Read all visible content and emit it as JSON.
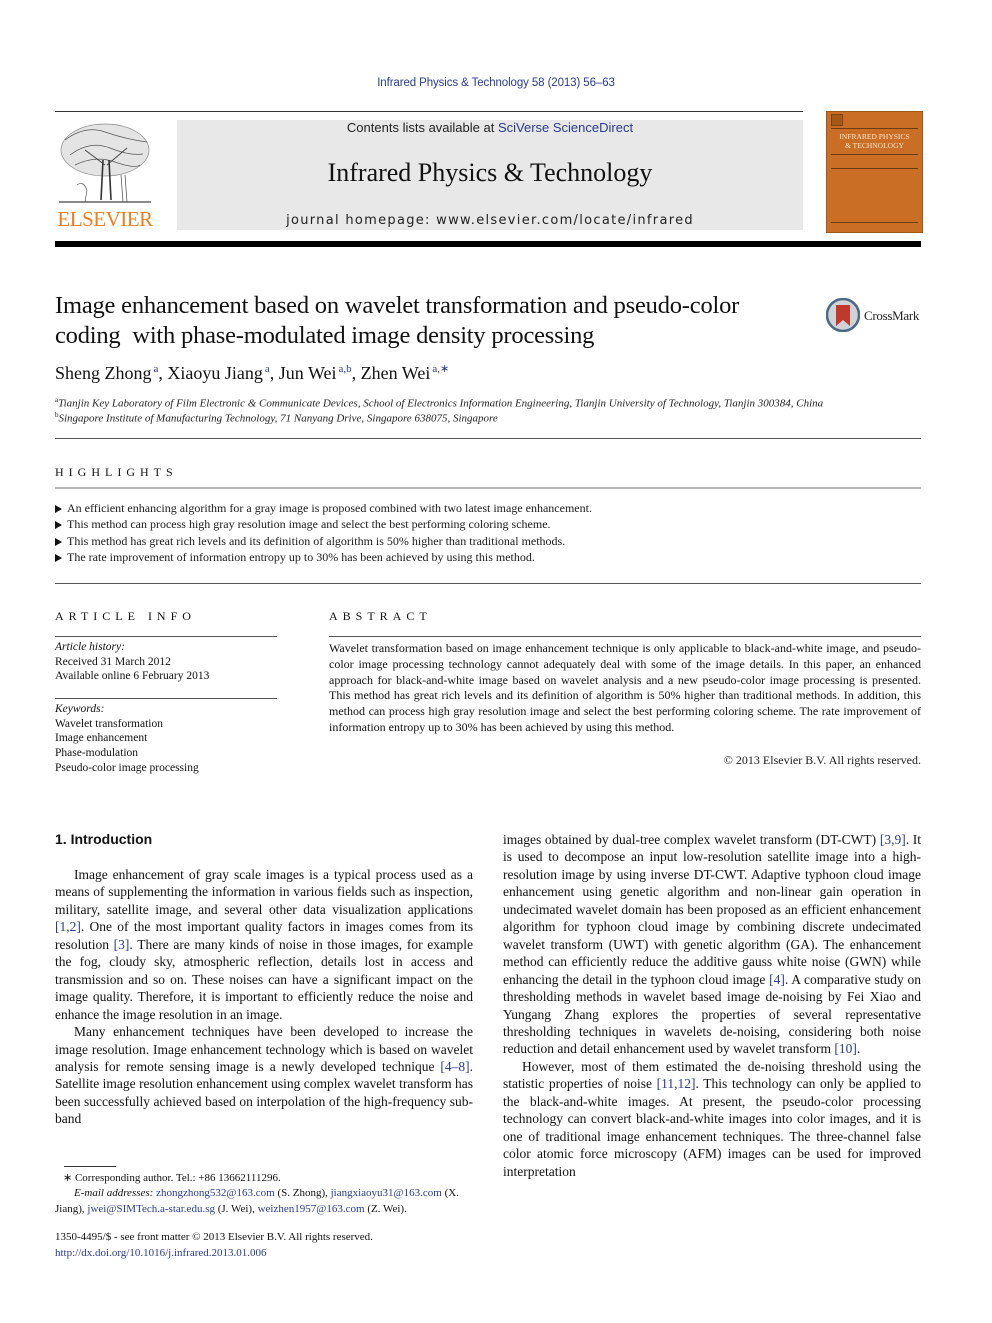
{
  "header": {
    "citation": "Infrared Physics & Technology 58 (2013) 56–63",
    "contents_prefix": "Contents lists available at ",
    "contents_link": "SciVerse ScienceDirect",
    "journal_title": "Infrared Physics & Technology",
    "homepage_label": "journal homepage: ",
    "homepage_url": "www.elsevier.com/locate/infrared",
    "publisher_logo_text": "ELSEVIER",
    "cover_title_line1": "INFRARED PHYSICS",
    "cover_title_line2": "& TECHNOLOGY",
    "crossmark_label": "CrossMark"
  },
  "colors": {
    "link": "#2a3a8c",
    "elsevier_orange": "#f07c1c",
    "cover_orange": "#c96e24",
    "header_gray": "#e8e8e8"
  },
  "article": {
    "title_line1": "Image enhancement based on wavelet transformation and pseudo-color",
    "title_line2": "coding  with phase-modulated image density processing",
    "authors": [
      {
        "name": "Sheng Zhong",
        "sup": "a",
        "sep": ", "
      },
      {
        "name": "Xiaoyu Jiang",
        "sup": "a",
        "sep": ", "
      },
      {
        "name": "Jun Wei",
        "sup": "a,b",
        "sep": ", "
      },
      {
        "name": "Zhen Wei",
        "sup": "a,∗",
        "sep": ""
      }
    ],
    "affiliations": [
      {
        "mark": "a",
        "text": "Tianjin Key Laboratory of Film Electronic & Communicate Devices, School of Electronics Information Engineering, Tianjin University of Technology, Tianjin 300384, China"
      },
      {
        "mark": "b",
        "text": "Singapore Institute of Manufacturing Technology, 71 Nanyang Drive, Singapore 638075, Singapore"
      }
    ]
  },
  "highlights": {
    "title": "HIGHLIGHTS",
    "items": [
      "An efficient enhancing algorithm for a gray image is proposed combined with two latest image enhancement.",
      "This method can process high gray resolution image and select the best performing coloring scheme.",
      "This method has great rich levels and its definition of algorithm is 50% higher than traditional methods.",
      "The rate improvement of information entropy up to 30% has been achieved by using this method."
    ]
  },
  "article_info": {
    "title": "ARTICLE INFO",
    "history_label": "Article history:",
    "received": "Received 31 March 2012",
    "available": "Available online 6 February 2013",
    "keywords_label": "Keywords:",
    "keywords": [
      "Wavelet transformation",
      "Image enhancement",
      "Phase-modulation",
      "Pseudo-color image processing"
    ]
  },
  "abstract": {
    "title": "ABSTRACT",
    "text": "Wavelet transformation based on image enhancement technique is only applicable to black-and-white image, and pseudo-color image processing technology cannot adequately deal with some of the image details. In this paper, an enhanced approach for black-and-white image based on wavelet analysis and a new pseudo-color image processing is presented. This method has great rich levels and its definition of algorithm is 50% higher than traditional methods. In addition, this method can process high gray resolution image and select the best performing coloring scheme. The rate improvement of information entropy up to 30% has been achieved by using this method.",
    "copyright": "© 2013 Elsevier B.V. All rights reserved."
  },
  "intro": {
    "heading": "1. Introduction",
    "p1_a": "Image enhancement of gray scale images is a typical process used as a means of supplementing the information in various fields such as inspection, military, satellite image, and several other data visualization applications ",
    "p1_ref1": "[1,2]",
    "p1_b": ". One of the most important quality factors in images comes from its resolution ",
    "p1_ref2": "[3]",
    "p1_c": ". There are many kinds of noise in those images, for example the fog, cloudy sky, atmospheric reflection, details lost in access and transmission and so on. These noises can have a significant impact on the image quality. Therefore, it is important to efficiently reduce the noise and enhance the image resolution in an image.",
    "p2_a": "Many enhancement techniques have been developed to increase the image resolution. Image enhancement technology which is based on wavelet analysis for remote sensing image is a newly developed technique ",
    "p2_ref1": "[4–8]",
    "p2_b": ". Satellite image resolution enhancement using complex wavelet transform has been successfully achieved based on interpolation of the high-frequency sub-band",
    "r1_a": "images obtained by dual-tree complex wavelet transform (DT-CWT) ",
    "r1_ref1": "[3,9]",
    "r1_b": ". It is used to decompose an input low-resolution satellite image into a high-resolution image by using inverse DT-CWT. Adaptive typhoon cloud image enhancement using genetic algorithm and non-linear gain operation in undecimated wavelet domain has been proposed as an efficient enhancement algorithm for typhoon cloud image by combining discrete undecimated wavelet transform (UWT) with genetic algorithm (GA). The enhancement method can efficiently reduce the additive gauss white noise (GWN) while enhancing the detail in the typhoon cloud image ",
    "r1_ref2": "[4]",
    "r1_c": ". A comparative study on thresholding methods in wavelet based image de-noising by Fei Xiao and Yungang Zhang explores the properties of several representative thresholding techniques in wavelets de-noising, considering both noise reduction and detail enhancement used by wavelet transform ",
    "r1_ref3": "[10]",
    "r1_d": ".",
    "r2_a": "However, most of them estimated the de-noising threshold using the statistic properties of noise ",
    "r2_ref1": "[11,12]",
    "r2_b": ". This technology can only be applied to the black-and-white images. At present, the pseudo-color processing technology can convert black-and-white images into color images, and it is one of traditional image enhancement techniques. The three-channel false color atomic force microscopy (AFM) images can be used for improved interpretation"
  },
  "footnotes": {
    "star": "∗ Corresponding author. Tel.: +86 13662111296.",
    "email_label": "E-mail addresses: ",
    "emails": [
      {
        "addr": "zhongzhong532@163.com",
        "who": " (S. Zhong), "
      },
      {
        "addr": "jiangxiaoyu31@163.com",
        "who": " (X. Jiang), "
      },
      {
        "addr": "jwei@SIMTech.a-star.edu.sg",
        "who": " (J. Wei), "
      },
      {
        "addr": "weizhen1957@163.com",
        "who": " (Z. Wei)."
      }
    ],
    "front_matter": "1350-4495/$ - see front matter © 2013 Elsevier B.V. All rights reserved.",
    "doi": "http://dx.doi.org/10.1016/j.infrared.2013.01.006"
  }
}
